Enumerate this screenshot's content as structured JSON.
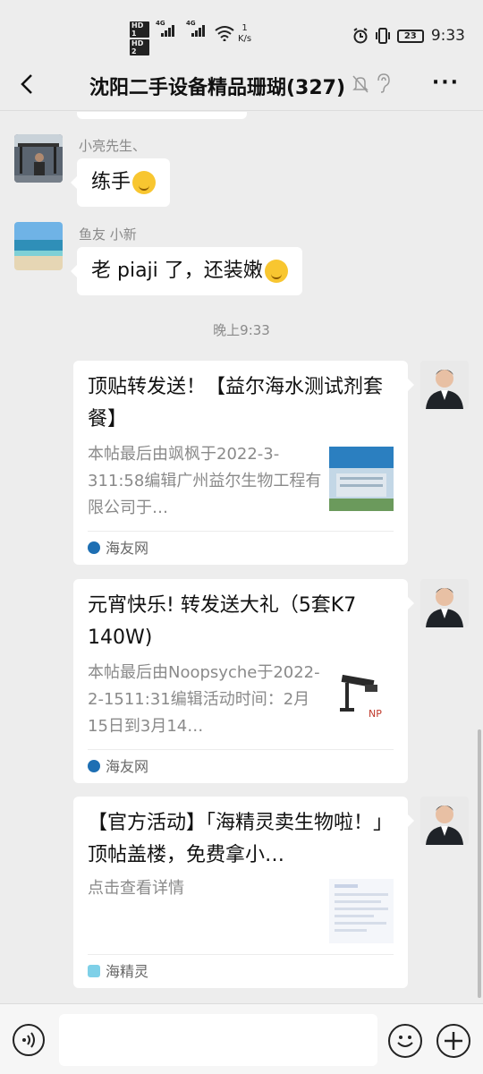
{
  "status_bar": {
    "hd1": "HD 1",
    "hd2": "HD 2",
    "net1": "4G",
    "net2": "4G",
    "speed_value": "1",
    "speed_unit": "K/s",
    "battery": "23",
    "time": "9:33"
  },
  "header": {
    "title": "沈阳二手设备精品珊瑚(327)",
    "back_icon": "chevron-left-icon",
    "mute_icon": "bell-off-icon",
    "ear_icon": "ear-icon",
    "more_label": "···"
  },
  "messages": [
    {
      "sender": "小亮先生、",
      "text": "练手",
      "emoji": "grimacing-emoji"
    },
    {
      "sender": "鱼友 小新",
      "text": "老 piaji 了，还装嫩",
      "emoji": "laughing-tears-emoji"
    }
  ],
  "timestamp": "晚上9:33",
  "cards": [
    {
      "title": "顶贴转发送！【益尔海水测试剂套餐】",
      "desc": "本帖最后由飒枫于2022-3-311:58编辑广州益尔生物工程有限公司于…",
      "source": "海友网"
    },
    {
      "title": "元宵快乐! 转发送大礼（5套K7 140W)",
      "desc": "本帖最后由Noopsyche于2022-2-1511:31编辑活动时间：2月15日到3月14…",
      "source": "海友网"
    },
    {
      "title": "【官方活动】「海精灵卖生物啦！」顶帖盖楼，免费拿小…",
      "desc": "点击查看详情",
      "source": "海精灵"
    }
  ],
  "colors": {
    "background": "#ededed",
    "bubble": "#ffffff",
    "meta_text": "#8a8a8a"
  }
}
